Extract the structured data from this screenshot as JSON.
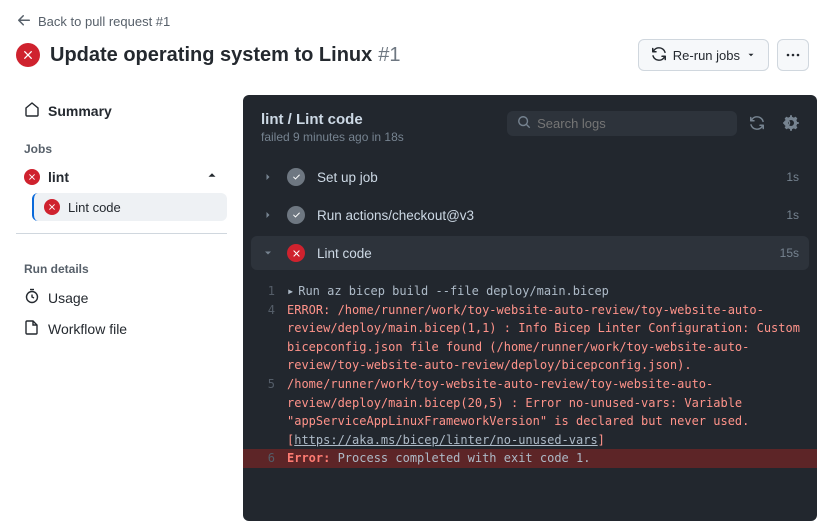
{
  "header": {
    "back_label": "Back to pull request #1",
    "title": "Update operating system to Linux",
    "issue_number": "#1",
    "rerun_label": "Re-run jobs"
  },
  "sidebar": {
    "summary_label": "Summary",
    "jobs_heading": "Jobs",
    "job_name": "lint",
    "job_step": "Lint code",
    "run_details_heading": "Run details",
    "usage_label": "Usage",
    "workflow_file_label": "Workflow file"
  },
  "log": {
    "title": "lint / Lint code",
    "status_line": "failed 9 minutes ago in 18s",
    "search_placeholder": "Search logs",
    "steps": [
      {
        "name": "Set up job",
        "duration": "1s",
        "status": "success",
        "expanded": false
      },
      {
        "name": "Run actions/checkout@v3",
        "duration": "1s",
        "status": "success",
        "expanded": false
      },
      {
        "name": "Lint code",
        "duration": "15s",
        "status": "failure",
        "expanded": true
      }
    ],
    "lines": [
      {
        "n": "1",
        "kind": "cmd",
        "text": "Run az bicep build --file deploy/main.bicep"
      },
      {
        "n": "4",
        "kind": "err",
        "text": "ERROR: /home/runner/work/toy-website-auto-review/toy-website-auto-review/deploy/main.bicep(1,1) : Info Bicep Linter Configuration: Custom bicepconfig.json file found (/home/runner/work/toy-website-auto-review/toy-website-auto-review/deploy/bicepconfig.json)."
      },
      {
        "n": "5",
        "kind": "err",
        "text_prefix": "/home/runner/work/toy-website-auto-review/toy-website-auto-review/deploy/main.bicep(20,5) : Error no-unused-vars: Variable \"appServiceAppLinuxFrameworkVersion\" is declared but never used. [",
        "link": "https://aka.ms/bicep/linter/no-unused-vars",
        "text_suffix": "]"
      },
      {
        "n": "6",
        "kind": "final",
        "kw": "Error:",
        "rest": " Process completed with exit code 1."
      }
    ]
  }
}
